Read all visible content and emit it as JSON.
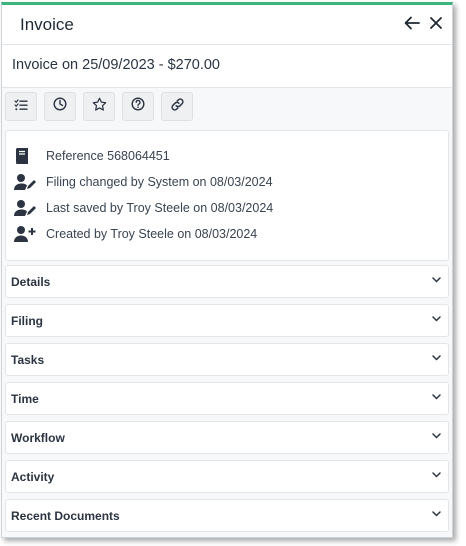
{
  "window": {
    "title": "Invoice"
  },
  "header": {
    "subtitle": "Invoice on 25/09/2023 - $270.00"
  },
  "toolbar": {
    "buttons": [
      {
        "icon": "checklist-icon"
      },
      {
        "icon": "clock-icon"
      },
      {
        "icon": "star-icon"
      },
      {
        "icon": "help-icon"
      },
      {
        "icon": "link-icon"
      }
    ]
  },
  "info": {
    "reference": "Reference 568064451",
    "filing_changed": "Filing changed by System on 08/03/2024",
    "last_saved": "Last saved by Troy Steele on 08/03/2024",
    "created": "Created by Troy Steele on 08/03/2024"
  },
  "sections": [
    {
      "label": "Details"
    },
    {
      "label": "Filing"
    },
    {
      "label": "Tasks"
    },
    {
      "label": "Time"
    },
    {
      "label": "Workflow"
    },
    {
      "label": "Activity"
    },
    {
      "label": "Recent Documents"
    }
  ],
  "colors": {
    "accent": "#3bb47e",
    "icon": "#2b3440",
    "panel_bg": "#f7f8f9"
  }
}
